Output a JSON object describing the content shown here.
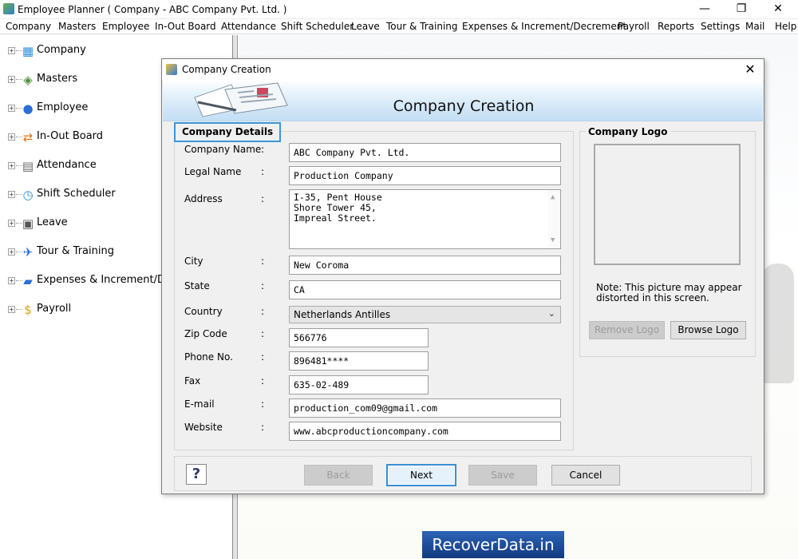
{
  "window": {
    "title": "Employee Planner ( Company - ABC Company Pvt. Ltd. )",
    "min_glyph": "—",
    "max_glyph": "❐",
    "close_glyph": "✕"
  },
  "menu": [
    {
      "label": "Company"
    },
    {
      "label": "Masters"
    },
    {
      "label": "Employee"
    },
    {
      "label": "In-Out Board"
    },
    {
      "label": "Attendance"
    },
    {
      "label": "Shift Scheduler"
    },
    {
      "label": "Leave"
    },
    {
      "label": "Tour & Training"
    },
    {
      "label": "Expenses & Increment/Decrement"
    },
    {
      "label": "Payroll"
    },
    {
      "label": "Reports"
    },
    {
      "label": "Settings"
    },
    {
      "label": "Mail"
    },
    {
      "label": "Help"
    }
  ],
  "tree": [
    {
      "label": "Company",
      "icon": "building-icon",
      "glyph": "▦",
      "color": "#2b8fd8"
    },
    {
      "label": "Masters",
      "icon": "layers-icon",
      "glyph": "◈",
      "color": "#4d8f3a"
    },
    {
      "label": "Employee",
      "icon": "people-icon",
      "glyph": "👥",
      "color": "#2b6fd8"
    },
    {
      "label": "In-Out Board",
      "icon": "arrows-icon",
      "glyph": "⇄",
      "color": "#e07a10"
    },
    {
      "label": "Attendance",
      "icon": "calendar-icon",
      "glyph": "▤",
      "color": "#666666"
    },
    {
      "label": "Shift Scheduler",
      "icon": "clock-icon",
      "glyph": "◷",
      "color": "#2b8fd8"
    },
    {
      "label": "Leave",
      "icon": "calendar-17-icon",
      "glyph": "▣",
      "color": "#555555"
    },
    {
      "label": "Tour & Training",
      "icon": "airplane-icon",
      "glyph": "✈",
      "color": "#2b6fd8"
    },
    {
      "label": "Expenses & Increment/Decrement",
      "icon": "wallet-icon",
      "glyph": "▰",
      "color": "#2b6fd8"
    },
    {
      "label": "Payroll",
      "icon": "coin-icon",
      "glyph": "$",
      "color": "#d8a010"
    }
  ],
  "dialog": {
    "title": "Company Creation",
    "heading": "Company Creation",
    "close_glyph": "✕",
    "details_legend": "Company Details",
    "fields": {
      "company_name": {
        "label": "Company Name",
        "value": "ABC Company Pvt. Ltd."
      },
      "legal_name": {
        "label": "Legal Name",
        "value": "Production Company"
      },
      "address": {
        "label": "Address",
        "lines": [
          "I-35, Pent House",
          "Shore Tower 45,",
          "Impreal Street."
        ]
      },
      "city": {
        "label": "City",
        "value": "New Coroma"
      },
      "state": {
        "label": "State",
        "value": "CA"
      },
      "country": {
        "label": "Country",
        "value": "Netherlands Antilles"
      },
      "zip": {
        "label": "Zip Code",
        "value": "566776"
      },
      "phone": {
        "label": "Phone No.",
        "value": "896481****"
      },
      "fax": {
        "label": "Fax",
        "value": "635-02-489"
      },
      "email": {
        "label": "E-mail",
        "value": "production_com09@gmail.com"
      },
      "website": {
        "label": "Website",
        "value": "www.abcproductioncompany.com"
      }
    },
    "colon": ":",
    "logo": {
      "legend": "Company Logo",
      "note": "Note: This picture may appear distorted in this screen.",
      "remove_label": "Remove Logo",
      "browse_label": "Browse Logo"
    },
    "buttons": {
      "help_glyph": "?",
      "back": "Back",
      "next": "Next",
      "save": "Save",
      "cancel": "Cancel"
    }
  },
  "watermark": "RecoverData.in"
}
